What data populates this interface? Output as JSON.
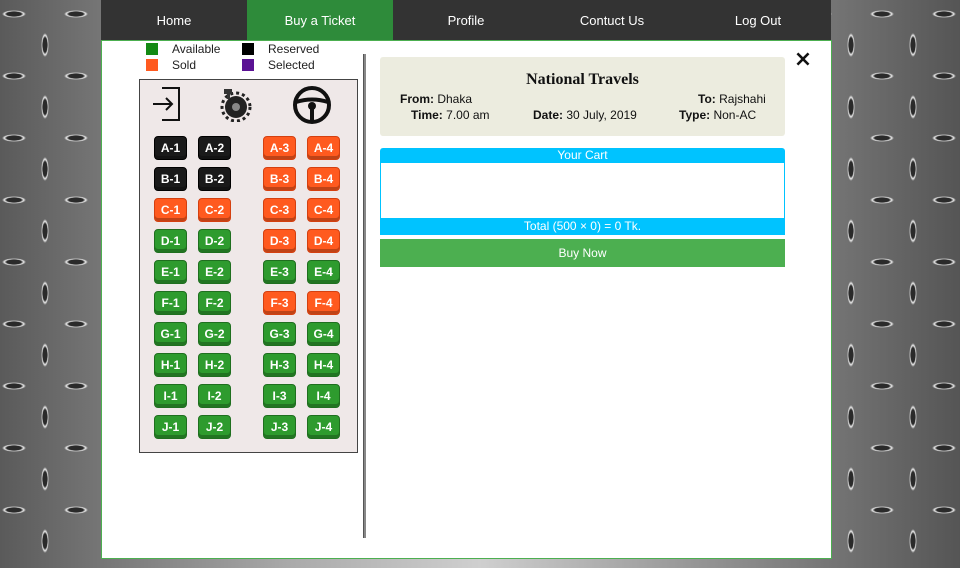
{
  "nav": {
    "items": [
      {
        "label": "Home",
        "active": false
      },
      {
        "label": "Buy a Ticket",
        "active": true
      },
      {
        "label": "Profile",
        "active": false
      },
      {
        "label": "Contuct Us",
        "active": false
      },
      {
        "label": "Log Out",
        "active": false
      }
    ]
  },
  "close_icon": "×",
  "legend": {
    "available": {
      "label": "Available",
      "color": "#138a13"
    },
    "reserved": {
      "label": "Reserved",
      "color": "#000000"
    },
    "sold": {
      "label": "Sold",
      "color": "#ff5a1f"
    },
    "selected": {
      "label": "Selected",
      "color": "#5b1294"
    }
  },
  "bus_icons": [
    "exit-door-icon",
    "engine-gear-icon",
    "steering-wheel-icon"
  ],
  "seats": {
    "rows": [
      [
        "A-1",
        "A-2",
        "A-3",
        "A-4"
      ],
      [
        "B-1",
        "B-2",
        "B-3",
        "B-4"
      ],
      [
        "C-1",
        "C-2",
        "C-3",
        "C-4"
      ],
      [
        "D-1",
        "D-2",
        "D-3",
        "D-4"
      ],
      [
        "E-1",
        "E-2",
        "E-3",
        "E-4"
      ],
      [
        "F-1",
        "F-2",
        "F-3",
        "F-4"
      ],
      [
        "G-1",
        "G-2",
        "G-3",
        "G-4"
      ],
      [
        "H-1",
        "H-2",
        "H-3",
        "H-4"
      ],
      [
        "I-1",
        "I-2",
        "I-3",
        "I-4"
      ],
      [
        "J-1",
        "J-2",
        "J-3",
        "J-4"
      ]
    ],
    "status": [
      [
        "reserved",
        "reserved",
        "sold",
        "sold"
      ],
      [
        "reserved",
        "reserved",
        "sold",
        "sold"
      ],
      [
        "sold",
        "sold",
        "sold",
        "sold"
      ],
      [
        "available",
        "available",
        "sold",
        "sold"
      ],
      [
        "available",
        "available",
        "available",
        "available"
      ],
      [
        "available",
        "available",
        "sold",
        "sold"
      ],
      [
        "available",
        "available",
        "available",
        "available"
      ],
      [
        "available",
        "available",
        "available",
        "available"
      ],
      [
        "available",
        "available",
        "available",
        "available"
      ],
      [
        "available",
        "available",
        "available",
        "available"
      ]
    ]
  },
  "trip": {
    "company": "National Travels",
    "from_label": "From:",
    "from": "Dhaka",
    "to_label": "To:",
    "to": "Rajshahi",
    "time_label": "Time:",
    "time": "7.00 am",
    "date_label": "Date:",
    "date": "30 July, 2019",
    "type_label": "Type:",
    "type": "Non-AC"
  },
  "cart": {
    "title": "Your Cart",
    "total": "Total (500 × 0) = 0 Tk.",
    "buy_label": "Buy Now"
  },
  "colors": {
    "nav_bg": "#333333",
    "nav_active": "#2e8b3a",
    "cart_accent": "#00c3ff",
    "buy_button": "#4caf50"
  }
}
